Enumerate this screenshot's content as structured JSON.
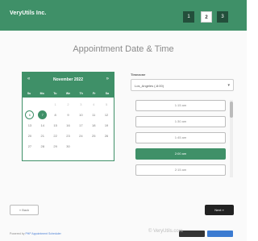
{
  "header": {
    "logo": "VeryUtils Inc.",
    "steps": [
      "1",
      "2",
      "3"
    ],
    "active_step": "2",
    "bg_color": "#3f9068"
  },
  "page_title": "Appointment Date & Time",
  "calendar": {
    "prev_icon": "«",
    "next_icon": "»",
    "month_label": "November 2022",
    "weekdays": [
      "Su",
      "Mo",
      "Tu",
      "We",
      "Th",
      "Fr",
      "Sa"
    ],
    "days": [
      {
        "label": "",
        "state": "empty"
      },
      {
        "label": "",
        "state": "empty"
      },
      {
        "label": "1",
        "state": "muted"
      },
      {
        "label": "2",
        "state": "muted"
      },
      {
        "label": "3",
        "state": "muted"
      },
      {
        "label": "4",
        "state": "muted"
      },
      {
        "label": "5",
        "state": "muted"
      },
      {
        "label": "6",
        "state": "today"
      },
      {
        "label": "7",
        "state": "selected"
      },
      {
        "label": "8",
        "state": "normal"
      },
      {
        "label": "9",
        "state": "normal"
      },
      {
        "label": "10",
        "state": "normal"
      },
      {
        "label": "11",
        "state": "normal"
      },
      {
        "label": "12",
        "state": "normal"
      },
      {
        "label": "13",
        "state": "normal"
      },
      {
        "label": "14",
        "state": "normal"
      },
      {
        "label": "15",
        "state": "normal"
      },
      {
        "label": "16",
        "state": "normal"
      },
      {
        "label": "17",
        "state": "normal"
      },
      {
        "label": "18",
        "state": "normal"
      },
      {
        "label": "19",
        "state": "normal"
      },
      {
        "label": "20",
        "state": "normal"
      },
      {
        "label": "21",
        "state": "normal"
      },
      {
        "label": "22",
        "state": "normal"
      },
      {
        "label": "23",
        "state": "normal"
      },
      {
        "label": "24",
        "state": "normal"
      },
      {
        "label": "25",
        "state": "normal"
      },
      {
        "label": "26",
        "state": "normal"
      },
      {
        "label": "27",
        "state": "normal"
      },
      {
        "label": "28",
        "state": "normal"
      },
      {
        "label": "29",
        "state": "normal"
      },
      {
        "label": "30",
        "state": "normal"
      }
    ]
  },
  "timezone": {
    "label": "Timezone",
    "value": "Los_Angeles (-8:00)",
    "arrow_icon": "chevron-down-icon"
  },
  "time_slots": [
    {
      "label": "1:15 am",
      "active": false
    },
    {
      "label": "1:30 am",
      "active": false
    },
    {
      "label": "1:45 am",
      "active": false
    },
    {
      "label": "2:00 am",
      "active": true
    },
    {
      "label": "2:15 am",
      "active": false
    }
  ],
  "buttons": {
    "back_label": "« Back",
    "next_label": "Next »"
  },
  "footer": {
    "prefix": "Powered by",
    "brand": "PHP Appointment Scheduler",
    "badge_1": "",
    "badge_2": ""
  },
  "watermark": "© VeryUtils.com"
}
